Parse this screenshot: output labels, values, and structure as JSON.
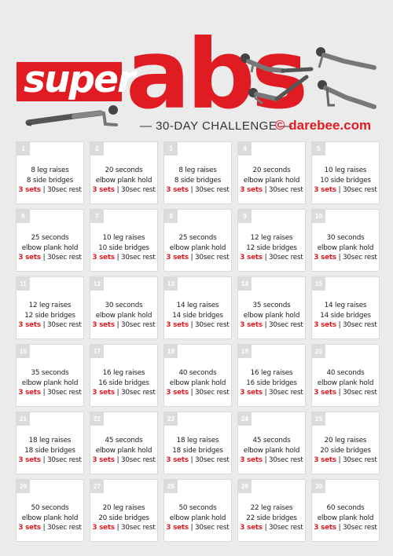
{
  "header": {
    "super": "super",
    "abs": "abs",
    "challenge": "— 30-DAY CHALLENGE —",
    "brand": "© darebee.com"
  },
  "days": [
    {
      "num": "1",
      "line1": "8 leg raises",
      "line2": "8 side bridges",
      "sets": "3 sets",
      "sep": "|",
      "rest": "30sec rest"
    },
    {
      "num": "2",
      "line1": "20 seconds",
      "line2": "elbow plank hold",
      "sets": "3 sets",
      "sep": "|",
      "rest": "30sec rest"
    },
    {
      "num": "3",
      "line1": "8 leg raises",
      "line2": "8 side bridges",
      "sets": "3 sets",
      "sep": "|",
      "rest": "30sec rest"
    },
    {
      "num": "4",
      "line1": "20 seconds",
      "line2": "elbow plank hold",
      "sets": "3 sets",
      "sep": "|",
      "rest": "30sec rest"
    },
    {
      "num": "5",
      "line1": "10 leg raises",
      "line2": "10 side bridges",
      "sets": "3 sets",
      "sep": "|",
      "rest": "30sec rest"
    },
    {
      "num": "6",
      "line1": "25 seconds",
      "line2": "elbow plank hold",
      "sets": "3 sets",
      "sep": "|",
      "rest": "30sec rest"
    },
    {
      "num": "7",
      "line1": "10 leg raises",
      "line2": "10 side bridges",
      "sets": "3 sets",
      "sep": "|",
      "rest": "30sec rest"
    },
    {
      "num": "8",
      "line1": "25 seconds",
      "line2": "elbow plank hold",
      "sets": "3 sets",
      "sep": "|",
      "rest": "30sec rest"
    },
    {
      "num": "9",
      "line1": "12 leg raises",
      "line2": "12 side bridges",
      "sets": "3 sets",
      "sep": "|",
      "rest": "30sec rest"
    },
    {
      "num": "10",
      "line1": "30 seconds",
      "line2": "elbow plank hold",
      "sets": "3 sets",
      "sep": "|",
      "rest": "30sec rest"
    },
    {
      "num": "11",
      "line1": "12 leg raises",
      "line2": "12 side bridges",
      "sets": "3 sets",
      "sep": "|",
      "rest": "30sec rest"
    },
    {
      "num": "12",
      "line1": "30 seconds",
      "line2": "elbow plank hold",
      "sets": "3 sets",
      "sep": "|",
      "rest": "30sec rest"
    },
    {
      "num": "13",
      "line1": "14 leg raises",
      "line2": "14 side bridges",
      "sets": "3 sets",
      "sep": "|",
      "rest": "30sec rest"
    },
    {
      "num": "14",
      "line1": "35 seconds",
      "line2": "elbow plank hold",
      "sets": "3 sets",
      "sep": "|",
      "rest": "30sec rest"
    },
    {
      "num": "15",
      "line1": "14 leg raises",
      "line2": "14 side bridges",
      "sets": "3 sets",
      "sep": "|",
      "rest": "30sec rest"
    },
    {
      "num": "16",
      "line1": "35 seconds",
      "line2": "elbow plank hold",
      "sets": "3 sets",
      "sep": "|",
      "rest": "30sec rest"
    },
    {
      "num": "17",
      "line1": "16 leg raises",
      "line2": "16 side bridges",
      "sets": "3 sets",
      "sep": "|",
      "rest": "30sec rest"
    },
    {
      "num": "18",
      "line1": "40 seconds",
      "line2": "elbow plank hold",
      "sets": "3 sets",
      "sep": "|",
      "rest": "30sec rest"
    },
    {
      "num": "19",
      "line1": "16 leg raises",
      "line2": "16 side bridges",
      "sets": "3 sets",
      "sep": "|",
      "rest": "30sec rest"
    },
    {
      "num": "20",
      "line1": "40 seconds",
      "line2": "elbow plank hold",
      "sets": "3 sets",
      "sep": "|",
      "rest": "30sec rest"
    },
    {
      "num": "21",
      "line1": "18 leg raises",
      "line2": "18 side bridges",
      "sets": "3 sets",
      "sep": "|",
      "rest": "30sec rest"
    },
    {
      "num": "22",
      "line1": "45 seconds",
      "line2": "elbow plank hold",
      "sets": "3 sets",
      "sep": "|",
      "rest": "30sec rest"
    },
    {
      "num": "23",
      "line1": "18 leg raises",
      "line2": "18 side bridges",
      "sets": "3 sets",
      "sep": "|",
      "rest": "30sec rest"
    },
    {
      "num": "24",
      "line1": "45 seconds",
      "line2": "elbow plank hold",
      "sets": "3 sets",
      "sep": "|",
      "rest": "30sec rest"
    },
    {
      "num": "25",
      "line1": "20 leg raises",
      "line2": "20 side bridges",
      "sets": "3 sets",
      "sep": "|",
      "rest": "30sec rest"
    },
    {
      "num": "26",
      "line1": "50 seconds",
      "line2": "elbow plank hold",
      "sets": "3 sets",
      "sep": "|",
      "rest": "30sec rest"
    },
    {
      "num": "27",
      "line1": "20 leg raises",
      "line2": "20 side bridges",
      "sets": "3 sets",
      "sep": "|",
      "rest": "30sec rest"
    },
    {
      "num": "28",
      "line1": "50 seconds",
      "line2": "elbow plank hold",
      "sets": "3 sets",
      "sep": "|",
      "rest": "30sec rest"
    },
    {
      "num": "29",
      "line1": "22 leg raises",
      "line2": "22 side bridges",
      "sets": "3 sets",
      "sep": "|",
      "rest": "30sec rest"
    },
    {
      "num": "30",
      "line1": "60 seconds",
      "line2": "elbow plank hold",
      "sets": "3 sets",
      "sep": "|",
      "rest": "30sec rest"
    }
  ],
  "colors": {
    "accent": "#e11b22",
    "background": "#ebebeb",
    "card": "#ffffff",
    "day_badge": "#dcdcdc"
  },
  "icons": [
    "plank-figure",
    "leg-raise-figure",
    "side-bridge-figure"
  ]
}
